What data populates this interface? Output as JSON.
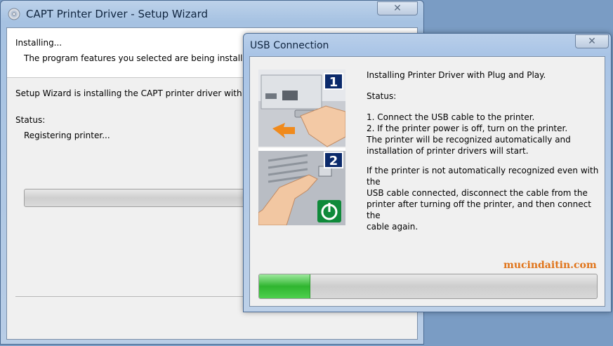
{
  "wizard": {
    "title": "CAPT Printer Driver - Setup Wizard",
    "header_title": "Installing...",
    "header_subtitle": "The program features you selected are being installed.",
    "description": "Setup Wizard is installing the CAPT printer driver with Plu",
    "status_label": "Status:",
    "status_value": "Registering printer...",
    "close_label": "✕"
  },
  "usb_dialog": {
    "title": "USB Connection",
    "close_label": "✕",
    "intro": "Installing Printer Driver with Plug and Play.",
    "status_label": "Status:",
    "step1": "1. Connect the USB cable to the printer.",
    "step2": "2. If the printer power is off, turn on the printer.",
    "recognized_line1": "The printer will be recognized automatically and",
    "recognized_line2": "installation of printer drivers will start.",
    "note_line1": "If the printer is not automatically recognized even with the",
    "note_line2": "USB cable connected, disconnect the cable from the",
    "note_line3": "printer after turning off the printer, and then connect the",
    "note_line4": "cable again.",
    "illustration_step1": "1",
    "illustration_step2": "2",
    "progress_fraction": 0.15
  },
  "watermark": "mucindaitin.com"
}
